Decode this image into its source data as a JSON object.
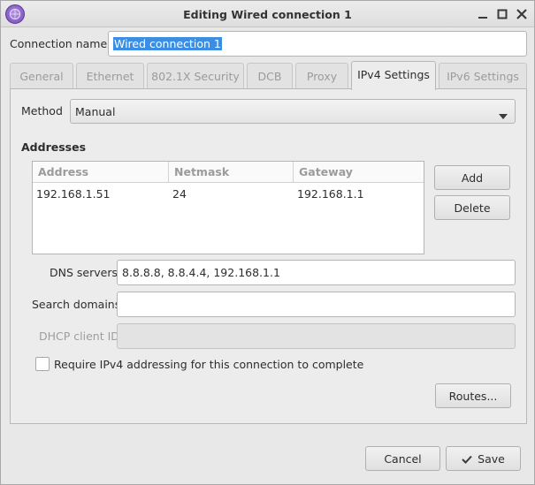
{
  "window": {
    "title": "Editing Wired connection 1"
  },
  "connection": {
    "name_label": "Connection name",
    "name_value": "Wired connection 1"
  },
  "tabs": [
    {
      "label": "General",
      "active": false
    },
    {
      "label": "Ethernet",
      "active": false
    },
    {
      "label": "802.1X Security",
      "active": false
    },
    {
      "label": "DCB",
      "active": false
    },
    {
      "label": "Proxy",
      "active": false
    },
    {
      "label": "IPv4 Settings",
      "active": true
    },
    {
      "label": "IPv6 Settings",
      "active": false
    }
  ],
  "ipv4": {
    "method_label": "Method",
    "method_value": "Manual",
    "addresses_title": "Addresses",
    "columns": [
      "Address",
      "Netmask",
      "Gateway"
    ],
    "rows": [
      [
        "192.168.1.51",
        "24",
        "192.168.1.1"
      ]
    ],
    "add_label": "Add",
    "delete_label": "Delete",
    "dns_label": "DNS servers",
    "dns_value": "8.8.8.8, 8.8.4.4, 192.168.1.1",
    "search_label": "Search domains",
    "search_value": "",
    "dhcp_label": "DHCP client ID",
    "dhcp_value": "",
    "require_label": "Require IPv4 addressing for this connection to complete",
    "require_checked": false,
    "routes_label": "Routes..."
  },
  "footer": {
    "cancel_label": "Cancel",
    "save_label": "Save"
  },
  "colors": {
    "selection": "#3b8ee4",
    "window_bg": "#e8e8e8",
    "icon_purple": "#8a63c8"
  }
}
